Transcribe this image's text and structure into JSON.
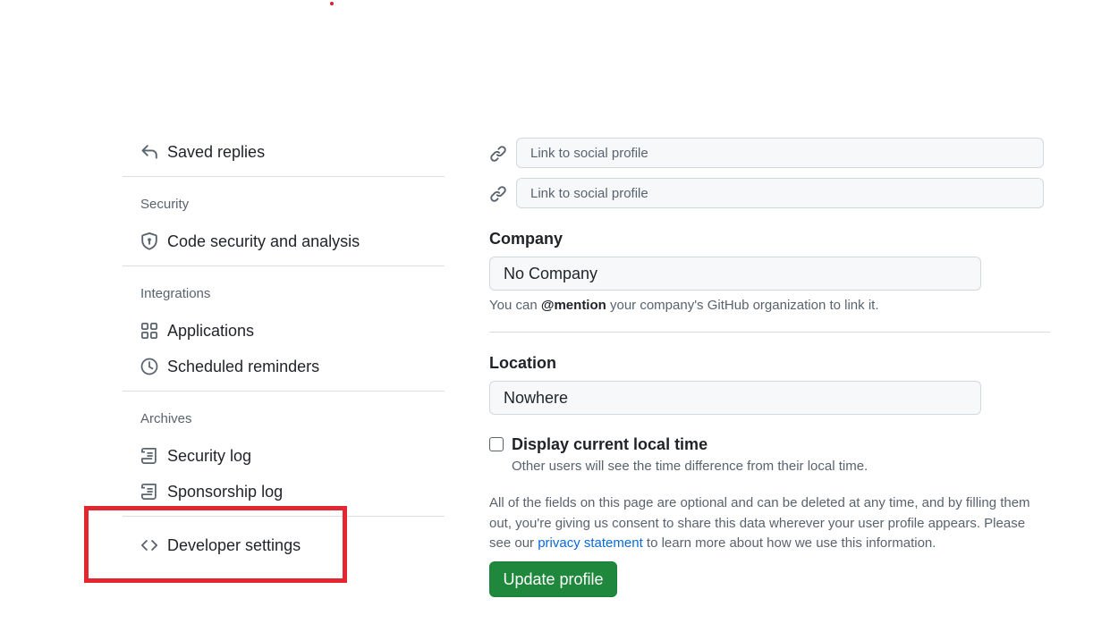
{
  "sidebar": {
    "saved_replies": {
      "label": "Saved replies",
      "icon": "reply-icon"
    },
    "security": {
      "heading": "Security",
      "items": [
        {
          "label": "Code security and analysis",
          "icon": "shield-icon"
        }
      ]
    },
    "integrations": {
      "heading": "Integrations",
      "items": [
        {
          "label": "Applications",
          "icon": "apps-grid-icon"
        },
        {
          "label": "Scheduled reminders",
          "icon": "clock-icon"
        }
      ]
    },
    "archives": {
      "heading": "Archives",
      "items": [
        {
          "label": "Security log",
          "icon": "log-icon"
        },
        {
          "label": "Sponsorship log",
          "icon": "log-icon"
        }
      ]
    },
    "developer_settings": {
      "label": "Developer settings",
      "icon": "code-icon"
    }
  },
  "profile": {
    "social": [
      {
        "placeholder": "Link to social profile",
        "value": ""
      },
      {
        "placeholder": "Link to social profile",
        "value": ""
      }
    ],
    "company": {
      "label": "Company",
      "value": "No Company",
      "note_prefix": "You can ",
      "note_mention": "@mention",
      "note_suffix": " your company's GitHub organization to link it."
    },
    "location": {
      "label": "Location",
      "value": "Nowhere"
    },
    "local_time": {
      "label": "Display current local time",
      "note": "Other users will see the time difference from their local time.",
      "checked": false
    },
    "disclaimer": {
      "text_before": "All of the fields on this page are optional and can be deleted at any time, and by filling them out, you're giving us consent to share this data wherever your user profile appears. Please see our ",
      "link": "privacy statement",
      "text_after": " to learn more about how we use this information."
    },
    "update_button": "Update profile"
  },
  "colors": {
    "accent_green": "#1f883d",
    "link_blue": "#0969da",
    "highlight_red": "#e3262f"
  }
}
